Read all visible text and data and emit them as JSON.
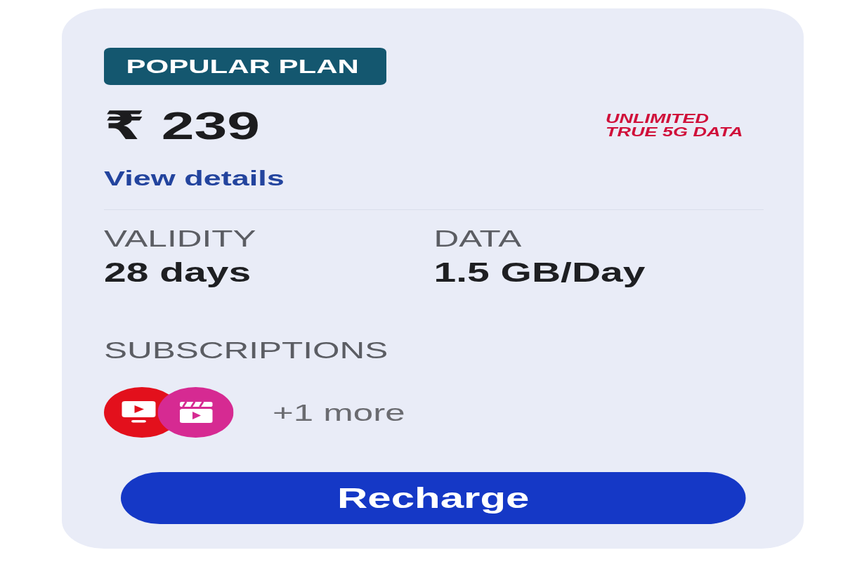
{
  "plan": {
    "badge": "POPULAR PLAN",
    "price": "₹ 239",
    "highlight": "UNLIMITED TRUE 5G DATA",
    "details_link": "View details"
  },
  "benefits": [
    {
      "label": "VALIDITY",
      "value": "28 days"
    },
    {
      "label": "DATA",
      "value": "1.5 GB/Day"
    }
  ],
  "subscriptions": {
    "title": "SUBSCRIPTIONS",
    "apps": [
      {
        "kind": "tv",
        "color": "#e3101c"
      },
      {
        "kind": "clapper",
        "color": "#d62a92"
      }
    ],
    "more": "+1 more"
  },
  "button": "Recharge"
}
